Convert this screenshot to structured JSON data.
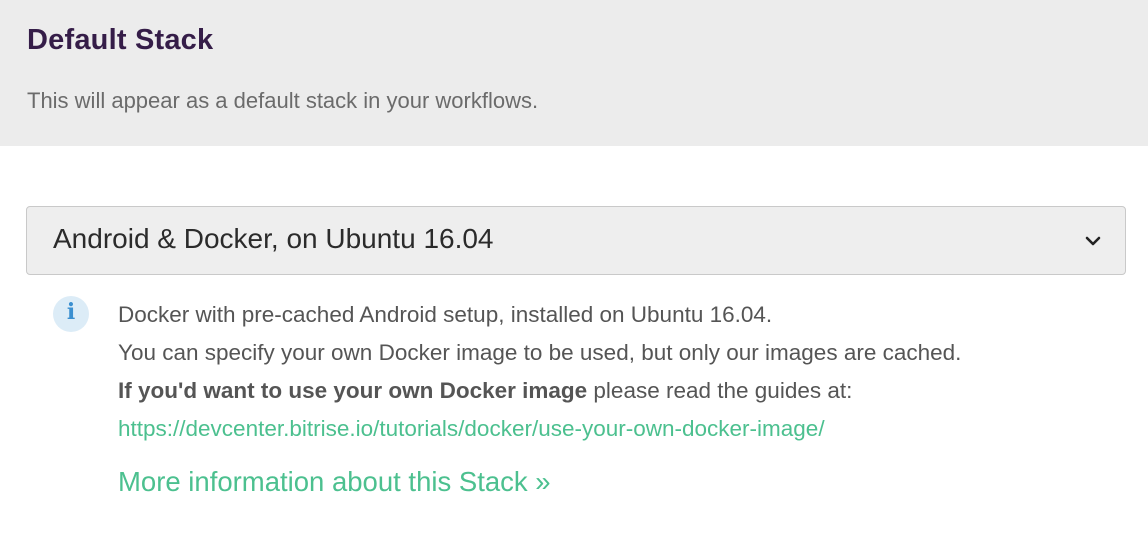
{
  "header": {
    "title": "Default Stack",
    "subtitle": "This will appear as a default stack in your workflows."
  },
  "stack_select": {
    "selected": "Android & Docker, on Ubuntu 16.04",
    "icon": "chevron-down-icon"
  },
  "info": {
    "icon": "info-icon",
    "icon_glyph": "i",
    "line1": "Docker with pre-cached Android setup, installed on Ubuntu 16.04.",
    "line2": "You can specify your own Docker image to be used, but only our images are cached.",
    "line3_bold": "If you'd want to use your own Docker image",
    "line3_rest": " please read the guides at:",
    "guide_link": "https://devcenter.bitrise.io/tutorials/docker/use-your-own-docker-image/",
    "more_link": "More information about this Stack »"
  },
  "colors": {
    "header_bg": "#ececec",
    "title": "#351d48",
    "link": "#4cc08f",
    "info_icon": "#3a8fd0",
    "info_icon_bg": "#dcecf7"
  }
}
